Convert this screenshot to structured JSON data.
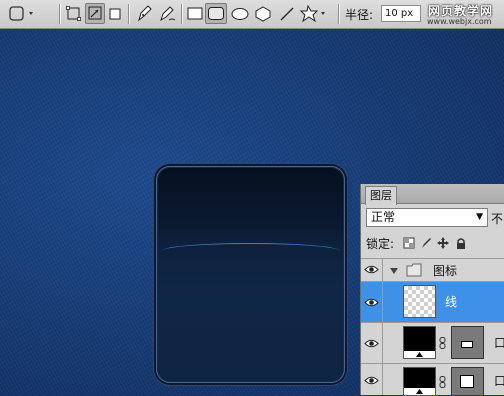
{
  "options_bar": {
    "radius_label": "半径:",
    "radius_value": "10 px",
    "watermark_title": "网页教学网",
    "watermark_url": "www.webjx.com",
    "tools": [
      "tool-preset-icon",
      "shape-layers-icon",
      "paths-icon",
      "fill-pixels-icon",
      "pen-icon",
      "freeform-pen-icon",
      "rectangle-icon",
      "rounded-rectangle-icon",
      "ellipse-icon",
      "polygon-icon",
      "line-icon",
      "custom-shape-icon"
    ],
    "selected_tool": "rounded-rectangle-icon"
  },
  "layers_panel": {
    "tab_label": "图层",
    "blend_mode": "正常",
    "opacity_label": "不",
    "lock_label": "锁定:",
    "layers": [
      {
        "name": "图标",
        "kind": "group",
        "expanded": true
      },
      {
        "name": "线",
        "kind": "layer",
        "selected": true
      },
      {
        "name": "",
        "kind": "shape-with-mask"
      },
      {
        "name": "",
        "kind": "shape-with-mask"
      }
    ]
  },
  "colors": {
    "canvas_bg": "#173d78",
    "selected_layer": "#3f91e8",
    "toolbar_bg": "#d4d4d4"
  }
}
